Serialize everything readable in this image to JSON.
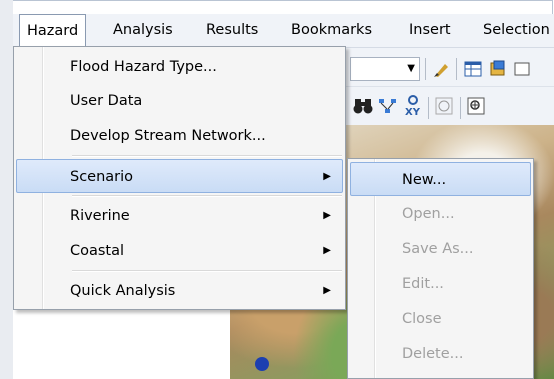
{
  "menubar": {
    "items": [
      {
        "label": "Hazard"
      },
      {
        "label": "Analysis"
      },
      {
        "label": "Results"
      },
      {
        "label": "Bookmarks"
      },
      {
        "label": "Insert"
      },
      {
        "label": "Selection"
      }
    ]
  },
  "toolbar": {
    "icons": [
      "dropdown-arrow-icon",
      "pen-icon",
      "table-icon",
      "layer-icon",
      "binoculars-icon",
      "find-route-icon",
      "go-to-xy-icon",
      "time-slider-icon",
      "zoom-window-icon"
    ],
    "xy_label": "XY"
  },
  "hazard_menu": {
    "items": [
      {
        "label": "Flood Hazard Type...",
        "has_submenu": false
      },
      {
        "label": "User Data",
        "has_submenu": false
      },
      {
        "label": "Develop Stream Network...",
        "has_submenu": false
      },
      {
        "label": "Scenario",
        "has_submenu": true,
        "highlighted": true
      },
      {
        "label": "Riverine",
        "has_submenu": true
      },
      {
        "label": "Coastal",
        "has_submenu": true
      },
      {
        "label": "Quick Analysis",
        "has_submenu": true
      }
    ]
  },
  "scenario_submenu": {
    "items": [
      {
        "label": "New...",
        "enabled": true,
        "highlighted": true
      },
      {
        "label": "Open...",
        "enabled": false
      },
      {
        "label": "Save As...",
        "enabled": false
      },
      {
        "label": "Edit...",
        "enabled": false
      },
      {
        "label": "Close",
        "enabled": false
      },
      {
        "label": "Delete...",
        "enabled": false
      }
    ]
  },
  "colors": {
    "menu_highlight": "#c9dcf5",
    "menu_highlight_border": "#8fb1e0",
    "disabled_text": "#a0a0a0",
    "menubar_bg": "#f0f3f8"
  }
}
